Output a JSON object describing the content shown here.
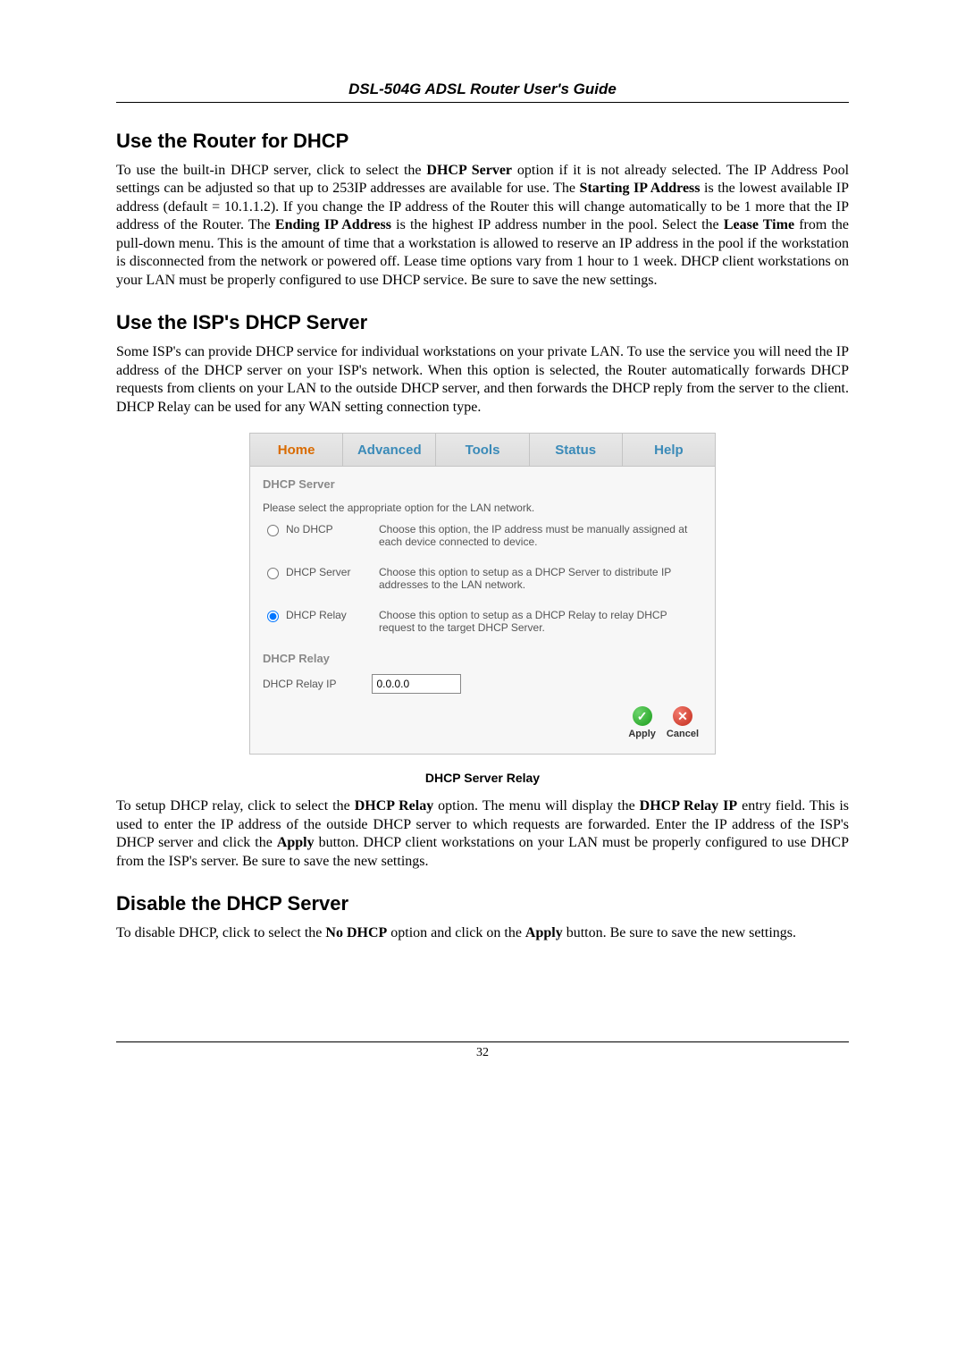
{
  "header": {
    "title": "DSL-504G ADSL Router User's Guide"
  },
  "section1": {
    "heading": "Use the Router for DHCP",
    "p_pre": "To use the built-in DHCP server, click to select the ",
    "p_bold1": "DHCP Server",
    "p_mid1": " option if it is not already selected. The IP Address Pool settings can be adjusted so that up to 253IP addresses are available for use. The ",
    "p_bold2": "Starting IP Address",
    "p_mid2": " is the lowest available IP address (default = 10.1.1.2). If you change the IP address of the Router this will change automatically to be 1 more that the IP address of the Router. The ",
    "p_bold3": "Ending IP Address",
    "p_mid3": " is the highest IP address number in the pool. Select the ",
    "p_bold4": "Lease Time",
    "p_post": " from the pull-down menu. This is the amount of time that a workstation is allowed to reserve an IP address in the pool if the workstation is disconnected from the network or powered off. Lease time options vary from 1 hour to 1 week. DHCP client workstations on your LAN must be properly configured to use DHCP service. Be sure to save the new settings."
  },
  "section2": {
    "heading": "Use the ISP's DHCP Server",
    "p": "Some ISP's can provide DHCP service for individual workstations on your private LAN. To use the service you will need the IP address of the DHCP server on your ISP's network. When this option is selected, the Router automatically forwards DHCP requests from clients on your LAN to the outside DHCP server, and then forwards the DHCP reply from the server to the client. DHCP Relay can be used for any WAN setting connection type."
  },
  "panel": {
    "tabs": {
      "home": "Home",
      "advanced": "Advanced",
      "tools": "Tools",
      "status": "Status",
      "help": "Help"
    },
    "title": "DHCP Server",
    "instruction": "Please select the appropriate option for the LAN network.",
    "options": {
      "nodhcp": {
        "label": "No DHCP",
        "desc": "Choose this option, the IP address must be manually assigned at each device connected to device."
      },
      "server": {
        "label": "DHCP Server",
        "desc": "Choose this option to setup as a DHCP Server to distribute IP addresses to the LAN network."
      },
      "relay": {
        "label": "DHCP Relay",
        "desc": "Choose this option to setup as a DHCP Relay to relay DHCP request to the target DHCP Server."
      }
    },
    "relay": {
      "heading": "DHCP Relay",
      "ip_label": "DHCP Relay IP",
      "ip_value": "0.0.0.0"
    },
    "actions": {
      "apply": "Apply",
      "cancel": "Cancel"
    }
  },
  "caption": "DHCP Server Relay",
  "section3": {
    "p_pre": "To setup DHCP relay, click to select the ",
    "p_bold1": "DHCP Relay",
    "p_mid1": " option. The menu will display the ",
    "p_bold2": "DHCP Relay IP",
    "p_mid2": " entry field. This is used to enter the IP address of the outside DHCP server to which requests are forwarded. Enter the IP address of the ISP's DHCP server and click the ",
    "p_bold3": "Apply",
    "p_post": " button.  DHCP client workstations on your LAN must be properly configured to use DHCP from the ISP's server. Be sure to save the new settings."
  },
  "section4": {
    "heading": "Disable the DHCP Server",
    "p_pre": "To disable DHCP, click to select the ",
    "p_bold1": "No DHCP",
    "p_mid1": " option and click on the ",
    "p_bold2": "Apply",
    "p_post": " button. Be sure to save the new settings."
  },
  "footer": {
    "page": "32"
  }
}
